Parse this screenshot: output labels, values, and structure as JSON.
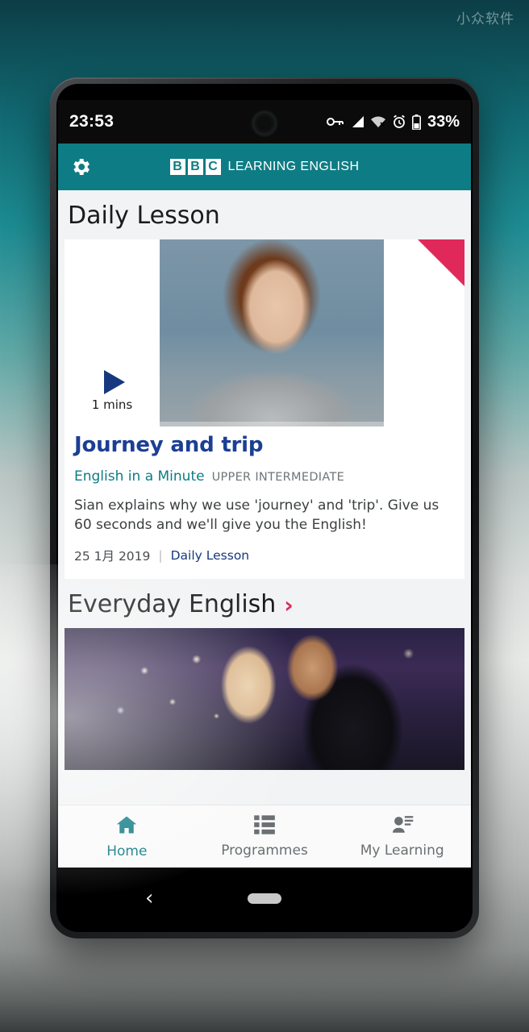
{
  "desktop": {
    "watermark": "小众软件"
  },
  "statusbar": {
    "time": "23:53",
    "battery_pct": "33%",
    "icons": [
      "vpn-key-icon",
      "signal-bars-icon",
      "wifi-off-icon",
      "alarm-clock-icon",
      "battery-icon"
    ]
  },
  "app_header": {
    "settings_icon": "gear-icon",
    "brand_blocks": [
      "B",
      "B",
      "C"
    ],
    "brand_text": "LEARNING ENGLISH",
    "brand_color": "#0e7c84"
  },
  "sections": {
    "daily_lesson": {
      "title": "Daily Lesson",
      "card": {
        "duration": "1 mins",
        "play_icon": "play-triangle-icon",
        "thumbnail_alt": "presenter-portrait",
        "corner_flag_color": "#e0285a",
        "title": "Journey and trip",
        "series": "English in a Minute",
        "level": "UPPER INTERMEDIATE",
        "description": "Sian explains why we use 'journey' and 'trip'. Give us 60 seconds and we'll give you the English!",
        "date": "25 1月 2019",
        "separator": "|",
        "category": "Daily Lesson"
      }
    },
    "everyday_english": {
      "title": "Everyday English",
      "chevron": "›",
      "chevron_color": "#e0285a",
      "thumbnail_alt": "dancing-couple-night-city"
    }
  },
  "bottom_nav": {
    "items": [
      {
        "label": "Home",
        "icon": "home-icon",
        "active": true
      },
      {
        "label": "Programmes",
        "icon": "list-grid-icon",
        "active": false
      },
      {
        "label": "My Learning",
        "icon": "person-lines-icon",
        "active": false
      }
    ],
    "active_color": "#0e7c84"
  },
  "android_nav": {
    "back": "‹",
    "home_pill": "home-pill"
  }
}
